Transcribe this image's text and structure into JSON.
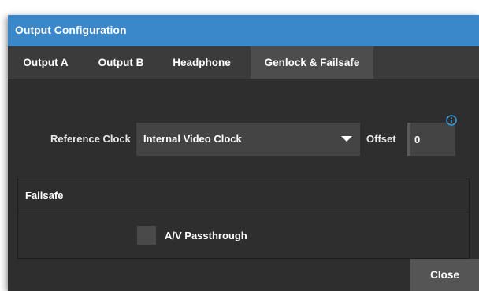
{
  "window": {
    "title": "Output Configuration",
    "accent_color": "#3a87c9"
  },
  "tabs": [
    {
      "label": "Output A",
      "active": false
    },
    {
      "label": "Output B",
      "active": false
    },
    {
      "label": "Headphone",
      "active": false
    },
    {
      "label": "Genlock & Failsafe",
      "active": true
    }
  ],
  "genlock": {
    "reference_clock_label": "Reference Clock",
    "reference_clock_value": "Internal Video Clock",
    "offset_label": "Offset",
    "offset_value": "0",
    "info_icon": "info-icon"
  },
  "failsafe": {
    "title": "Failsafe",
    "av_passthrough_label": "A/V Passthrough",
    "av_passthrough_checked": false
  },
  "footer": {
    "close_label": "Close"
  }
}
